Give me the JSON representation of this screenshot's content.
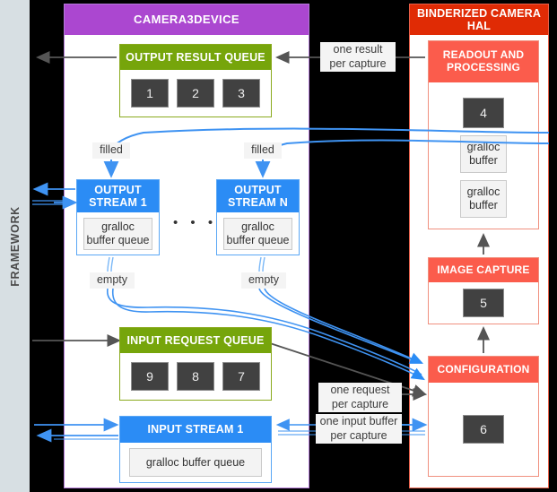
{
  "framework": {
    "label": "FRAMEWORK"
  },
  "camera3device": {
    "title": "CAMERA3DEVICE",
    "output_result_queue": {
      "title": "OUTPUT RESULT QUEUE",
      "chips": [
        "1",
        "2",
        "3"
      ]
    },
    "output_stream_1": {
      "title": "OUTPUT\nSTREAM 1",
      "buffer_label": "gralloc\nbuffer queue",
      "filled_label": "filled",
      "empty_label": "empty"
    },
    "output_stream_n": {
      "title": "OUTPUT\nSTREAM N",
      "buffer_label": "gralloc\nbuffer queue",
      "filled_label": "filled",
      "empty_label": "empty"
    },
    "ellipsis": "• • •",
    "input_request_queue": {
      "title": "INPUT REQUEST QUEUE",
      "chips": [
        "9",
        "8",
        "7"
      ]
    },
    "input_stream_1": {
      "title": "INPUT STREAM 1",
      "buffer_label": "gralloc buffer queue"
    }
  },
  "hal": {
    "title": "BINDERIZED CAMERA HAL",
    "readout": {
      "title": "READOUT AND PROCESSING",
      "chip": "4",
      "buffers": [
        "gralloc\nbuffer",
        "gralloc\nbuffer"
      ]
    },
    "image_capture": {
      "title": "IMAGE CAPTURE",
      "chip": "5"
    },
    "configuration": {
      "title": "CONFIGURATION",
      "chip": "6"
    }
  },
  "edge_labels": {
    "one_result_per_capture": "one result\nper capture",
    "one_request_per_capture": "one request\nper capture",
    "one_input_buffer_per_capture": "one input buffer\nper capture"
  },
  "colors": {
    "background": "#000000",
    "framework": "#d7dfe3",
    "camera3device_header": "#ab47d0",
    "hal_header": "#e02b05",
    "queue_green": "#76a50b",
    "stream_blue": "#2b8cf5",
    "hal_card_red": "#fb5c4c",
    "chip_dark": "#414141",
    "arrow_blue": "#2b8cf5",
    "arrow_gray": "#555555"
  }
}
